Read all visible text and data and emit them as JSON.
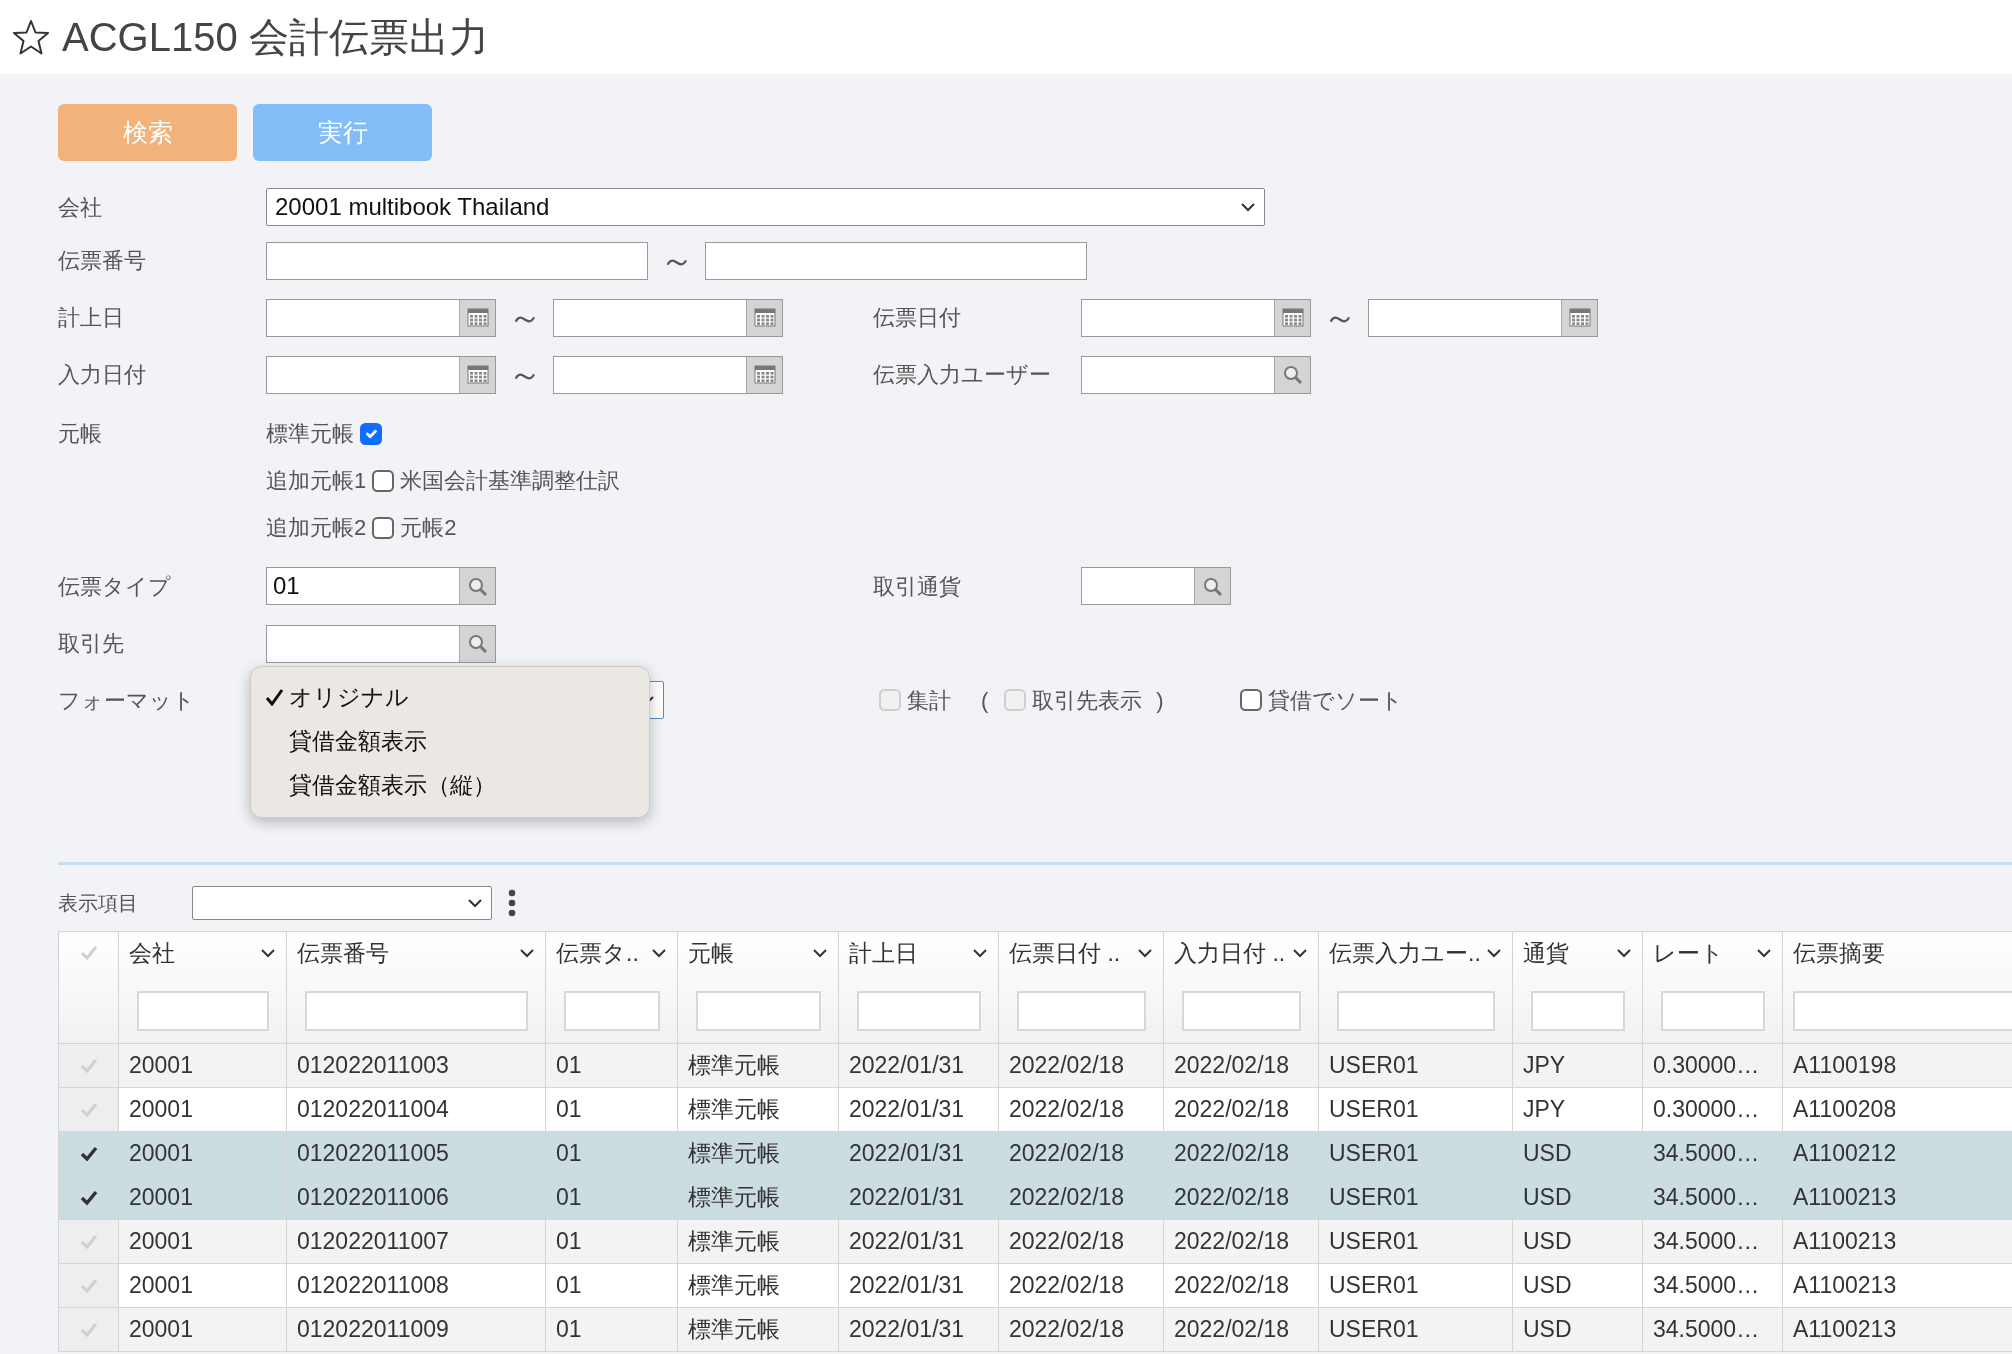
{
  "title": "ACGL150 会計伝票出力",
  "buttons": [
    {
      "label": "検索",
      "kind": "search"
    },
    {
      "label": "実行",
      "kind": "run"
    }
  ],
  "company": {
    "label": "会社",
    "value": "20001 multibook Thailand"
  },
  "voucher_no": {
    "label": "伝票番号",
    "separator": "～"
  },
  "posting_date": {
    "label": "計上日",
    "separator": "～"
  },
  "voucher_date": {
    "label": "伝票日付",
    "separator": "～"
  },
  "entry_date": {
    "label": "入力日付",
    "separator": "～"
  },
  "entry_user": {
    "label": "伝票入力ユーザー"
  },
  "ledger": {
    "label": "元帳",
    "lines": [
      {
        "caption": "標準元帳",
        "checked": true
      },
      {
        "caption": "追加元帳1",
        "checked": false,
        "text": "米国会計基準調整仕訳"
      },
      {
        "caption": "追加元帳2",
        "checked": false,
        "text": "元帳2"
      }
    ]
  },
  "voucher_type": {
    "label": "伝票タイプ",
    "value": "01"
  },
  "currency": {
    "label": "取引通貨"
  },
  "partner": {
    "label": "取引先"
  },
  "format": {
    "label": "フォーマット",
    "expanded": true,
    "options": [
      {
        "label": "オリジナル",
        "selected": true
      },
      {
        "label": "貸借金額表示",
        "selected": false
      },
      {
        "label": "貸借金額表示（縦）",
        "selected": false
      }
    ]
  },
  "summary": {
    "label": "集計",
    "checked": false,
    "disabled": true
  },
  "open_paren": "(",
  "show_partner": {
    "label": "取引先表示",
    "checked": false,
    "disabled": true
  },
  "close_paren": ")",
  "sort_by_dc": {
    "label": "貸借でソート",
    "checked": false,
    "disabled": false
  },
  "display_items": {
    "label": "表示項目"
  },
  "table": {
    "columns": [
      "会社",
      "伝票番号",
      "伝票タ..",
      "元帳",
      "計上日",
      "伝票日付 ..",
      "入力日付 ..",
      "伝票入力ユー..",
      "通貨",
      "レート",
      "伝票摘要"
    ],
    "rows": [
      {
        "selected": false,
        "cells": [
          "20001",
          "012022011003",
          "01",
          "標準元帳",
          "2022/01/31",
          "2022/02/18",
          "2022/02/18",
          "USER01",
          "JPY",
          "0.30000…",
          "A1100198"
        ]
      },
      {
        "selected": false,
        "cells": [
          "20001",
          "012022011004",
          "01",
          "標準元帳",
          "2022/01/31",
          "2022/02/18",
          "2022/02/18",
          "USER01",
          "JPY",
          "0.30000…",
          "A1100208"
        ]
      },
      {
        "selected": true,
        "cells": [
          "20001",
          "012022011005",
          "01",
          "標準元帳",
          "2022/01/31",
          "2022/02/18",
          "2022/02/18",
          "USER01",
          "USD",
          "34.5000…",
          "A1100212"
        ]
      },
      {
        "selected": true,
        "cells": [
          "20001",
          "012022011006",
          "01",
          "標準元帳",
          "2022/01/31",
          "2022/02/18",
          "2022/02/18",
          "USER01",
          "USD",
          "34.5000…",
          "A1100213"
        ]
      },
      {
        "selected": false,
        "cells": [
          "20001",
          "012022011007",
          "01",
          "標準元帳",
          "2022/01/31",
          "2022/02/18",
          "2022/02/18",
          "USER01",
          "USD",
          "34.5000…",
          "A1100213"
        ]
      },
      {
        "selected": false,
        "cells": [
          "20001",
          "012022011008",
          "01",
          "標準元帳",
          "2022/01/31",
          "2022/02/18",
          "2022/02/18",
          "USER01",
          "USD",
          "34.5000…",
          "A1100213"
        ]
      },
      {
        "selected": false,
        "cells": [
          "20001",
          "012022011009",
          "01",
          "標準元帳",
          "2022/01/31",
          "2022/02/18",
          "2022/02/18",
          "USER01",
          "USD",
          "34.5000…",
          "A1100213"
        ]
      }
    ]
  }
}
